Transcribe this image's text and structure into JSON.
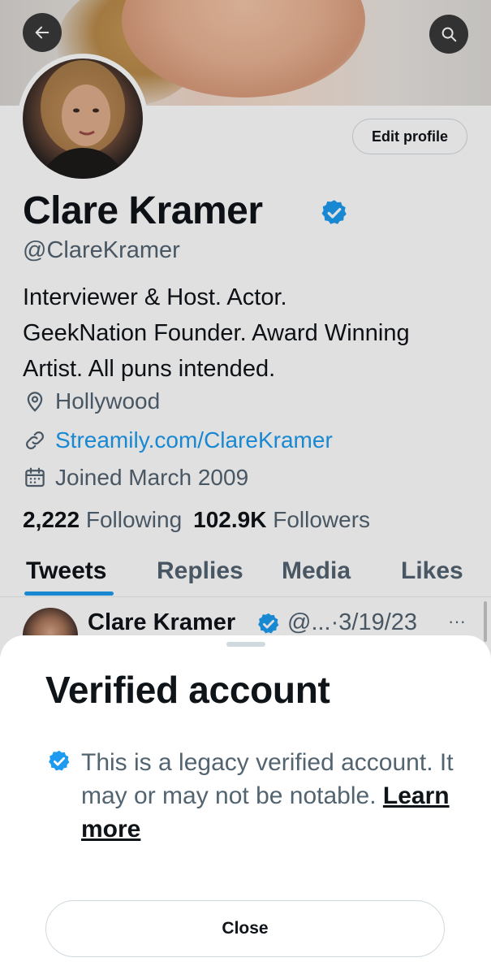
{
  "colors": {
    "accent": "#1d9bf0",
    "text_primary": "#0f1419",
    "text_secondary": "#536471",
    "border": "#cfd9de"
  },
  "header": {
    "back_icon": "arrow-left-icon",
    "search_icon": "search-icon"
  },
  "profile": {
    "edit_label": "Edit profile",
    "name": "Clare Kramer",
    "handle": "@ClareKramer",
    "bio_line1": "Interviewer & Host. Actor.",
    "bio_line2": "GeekNation Founder. Award Winning",
    "bio_line3": "Artist. All puns intended.",
    "location": "Hollywood",
    "website": "Streamily.com/ClareKramer",
    "joined": "Joined March 2009",
    "following_count": "2,222",
    "following_label": "Following",
    "followers_count": "102.9K",
    "followers_label": "Followers"
  },
  "tabs": [
    {
      "label": "Tweets",
      "active": true
    },
    {
      "label": "Replies",
      "active": false
    },
    {
      "label": "Media",
      "active": false
    },
    {
      "label": "Likes",
      "active": false
    }
  ],
  "tweet": {
    "name": "Clare Kramer",
    "handle_date": "@...·3/19/23",
    "more": "···"
  },
  "sheet": {
    "title": "Verified account",
    "text": "This is a legacy verified account. It may or may not be notable.",
    "learn_more": "Learn more",
    "close_label": "Close"
  }
}
